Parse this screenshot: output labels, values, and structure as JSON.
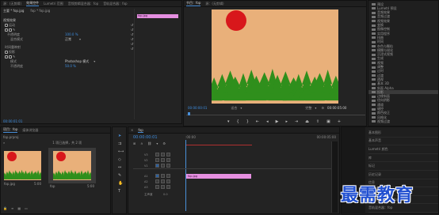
{
  "effect_controls": {
    "tabs": [
      "源：(无剪辑)",
      "效果控件",
      "Lumetri 范围",
      "音频剪辑混合器：fop",
      "音轨混合器：fop"
    ],
    "header_clip": "主要 * fop.jpg",
    "header_seq": "fop * fop.jpg",
    "clip_bar_label": "fop.jpg",
    "section_video": "视频效果",
    "rows": [
      {
        "label": "运动",
        "value": ""
      },
      {
        "label": "不透明度",
        "value": "100.0 %"
      },
      {
        "label": "混合模式",
        "value": "正常"
      },
      {
        "label": "时间重映射",
        "value": ""
      },
      {
        "label": "投影",
        "value": ""
      },
      {
        "label": "模式",
        "value": "Photoshop 模式"
      },
      {
        "label": "不透明度",
        "value": "50.0 %"
      }
    ],
    "timecode": "00:00:01:01"
  },
  "program_monitor": {
    "tabs": [
      "节目：fop",
      "源：(无剪辑)"
    ],
    "timecode_left": "00:00:00:01",
    "fit_label": "适合",
    "quality_label": "完整",
    "timecode_right": "00:00:05:00",
    "sky_color": "#e9b07a",
    "sun_color": "#d8171b",
    "tree_color": "#2f8f1c"
  },
  "effects_panel": {
    "items": [
      "预设",
      "Lumetri 预设",
      "音频效果",
      "音频过渡",
      "视频效果",
      "变换",
      "图像控制",
      "实用程序",
      "扭曲",
      "时间",
      "杂色与颗粒",
      "模糊与锐化",
      "沉浸式视频",
      "生成",
      "视频",
      "调整",
      "过时",
      "过渡",
      "透视",
      "基本 3D",
      "斜面 Alpha",
      "投影",
      "边缘斜面",
      "径向阴影",
      "通道",
      "键控",
      "颜色校正",
      "风格化",
      "视频过渡"
    ],
    "selected_index": 21
  },
  "project_panel": {
    "tabs": [
      "项目：fop",
      "媒体浏览器"
    ],
    "project_name": "fop.prproj",
    "count_label": "1 项已选择，共 2 项",
    "thumbs": [
      {
        "name": "fop.jpg",
        "duration": "5:00"
      },
      {
        "name": "fop",
        "duration": "5:00"
      }
    ]
  },
  "timeline": {
    "tab": "fop",
    "timecode": "00:00:00:01",
    "ruler_start": ":00:00",
    "ruler_mark": "00:00:05:00",
    "tracks": [
      "V3",
      "V2",
      "V1",
      "A1",
      "A2",
      "A3",
      "主声道"
    ],
    "master_value": "0.0",
    "clip_label": "fop.jpg"
  },
  "right_panel": {
    "items": [
      "基本图形",
      "基本声音",
      "Lumetri 颜色",
      "库",
      "标记",
      "历史记录",
      "信息",
      "效果",
      "音频剪辑混合器：fop",
      "音轨混合器：fop"
    ]
  },
  "watermark": "最需教育"
}
